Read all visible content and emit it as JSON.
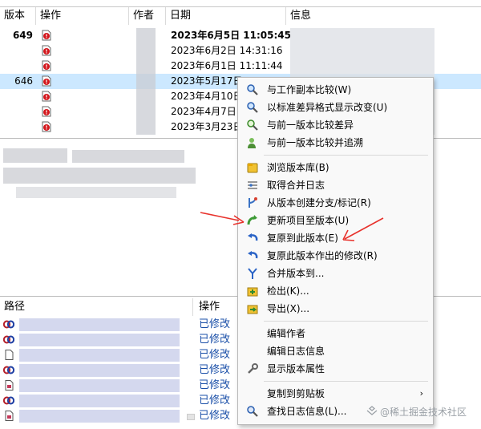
{
  "log_list": {
    "columns": {
      "version": "版本",
      "actions": "操作",
      "author": "作者",
      "date": "日期",
      "message": "信息"
    },
    "rows": [
      {
        "version": "649",
        "date": "2023年6月5日 11:05:45",
        "bold": true
      },
      {
        "version": "",
        "date": "2023年6月2日 14:31:16",
        "bold": false
      },
      {
        "version": "",
        "date": "2023年6月1日 11:11:44",
        "bold": false
      },
      {
        "version": "646",
        "date": "2023年5月17日 ",
        "bold": false,
        "selected": true
      },
      {
        "version": "",
        "date": "2023年4月10日",
        "bold": false
      },
      {
        "version": "",
        "date": "2023年4月7日 1",
        "bold": false
      },
      {
        "version": "",
        "date": "2023年3月23日",
        "bold": false
      }
    ]
  },
  "path_list": {
    "columns": {
      "path": "路径",
      "action": "操作"
    },
    "rows": [
      {
        "action": "已修改"
      },
      {
        "action": "已修改"
      },
      {
        "action": "已修改"
      },
      {
        "action": "已修改"
      },
      {
        "action": "已修改"
      },
      {
        "action": "已修改"
      },
      {
        "action": "已修改"
      }
    ]
  },
  "context_menu": {
    "items": [
      {
        "label": "与工作副本比较(W)",
        "icon": "compare-magnifier-icon"
      },
      {
        "label": "以标准差异格式显示改变(U)",
        "icon": "diff-magnifier-icon"
      },
      {
        "label": "与前一版本比较差异",
        "icon": "compare-prev-icon"
      },
      {
        "label": "与前一版本比较并追溯",
        "icon": "blame-prev-icon"
      },
      {
        "label": "浏览版本库(B)",
        "icon": "repo-browser-icon"
      },
      {
        "label": "取得合并日志",
        "icon": "merge-log-icon"
      },
      {
        "label": "从版本创建分支/标记(R)",
        "icon": "branch-tag-icon"
      },
      {
        "label": "更新项目至版本(U)",
        "icon": "update-to-revision-icon"
      },
      {
        "label": "复原到此版本(E)",
        "icon": "revert-to-revision-icon"
      },
      {
        "label": "复原此版本作出的修改(R)",
        "icon": "revert-changes-icon"
      },
      {
        "label": "合并版本到...",
        "icon": "merge-revision-icon"
      },
      {
        "label": "检出(K)...",
        "icon": "checkout-icon"
      },
      {
        "label": "导出(X)...",
        "icon": "export-icon"
      },
      {
        "label": "编辑作者",
        "icon": ""
      },
      {
        "label": "编辑日志信息",
        "icon": ""
      },
      {
        "label": "显示版本属性",
        "icon": "wrench-icon"
      },
      {
        "label": "复制到剪贴板",
        "icon": "",
        "submenu": "›"
      },
      {
        "label": "查找日志信息(L)...",
        "icon": "find-magnifier-icon"
      }
    ]
  },
  "watermark": "@稀土掘金技术社区",
  "colors": {
    "selected_row": "#cce8ff",
    "modified_link": "#1a4fa8",
    "arrow": "#e8322c"
  }
}
